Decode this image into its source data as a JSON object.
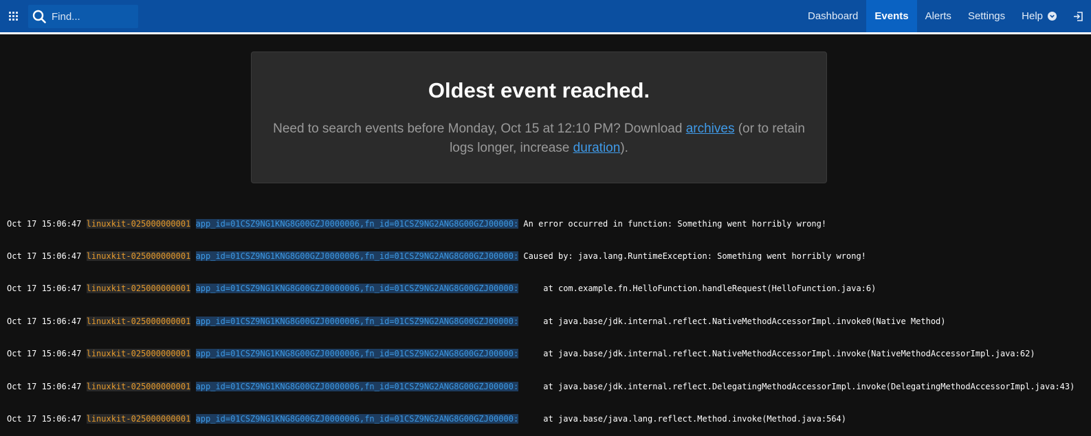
{
  "search": {
    "placeholder": "Find..."
  },
  "nav": {
    "items": [
      {
        "label": "Dashboard"
      },
      {
        "label": "Events",
        "active": true
      },
      {
        "label": "Alerts"
      },
      {
        "label": "Settings"
      },
      {
        "label": "Help"
      }
    ]
  },
  "banner": {
    "title": "Oldest event reached.",
    "message_prefix": "Need to search events before Monday, Oct 15 at 12:10 PM? Download ",
    "archives_link": "archives",
    "message_middle": " (or to retain logs longer, increase ",
    "duration_link": "duration",
    "message_suffix": ")."
  },
  "log": {
    "lines": [
      {
        "time": "Oct 17 15:06:47",
        "host": "linuxkit-025000000001",
        "ids": "app_id=01CSZ9NG1KNG8G00GZJ0000006,fn_id=01CSZ9NG2ANG8G00GZJ00000:",
        "message": "An error occurred in function: Something went horribly wrong!"
      },
      {
        "time": "Oct 17 15:06:47",
        "host": "linuxkit-025000000001",
        "ids": "app_id=01CSZ9NG1KNG8G00GZJ0000006,fn_id=01CSZ9NG2ANG8G00GZJ00000:",
        "message": "Caused by: java.lang.RuntimeException: Something went horribly wrong!"
      },
      {
        "time": "Oct 17 15:06:47",
        "host": "linuxkit-025000000001",
        "ids": "app_id=01CSZ9NG1KNG8G00GZJ0000006,fn_id=01CSZ9NG2ANG8G00GZJ00000:",
        "message": "    at com.example.fn.HelloFunction.handleRequest(HelloFunction.java:6)"
      },
      {
        "time": "Oct 17 15:06:47",
        "host": "linuxkit-025000000001",
        "ids": "app_id=01CSZ9NG1KNG8G00GZJ0000006,fn_id=01CSZ9NG2ANG8G00GZJ00000:",
        "message": "    at java.base/jdk.internal.reflect.NativeMethodAccessorImpl.invoke0(Native Method)"
      },
      {
        "time": "Oct 17 15:06:47",
        "host": "linuxkit-025000000001",
        "ids": "app_id=01CSZ9NG1KNG8G00GZJ0000006,fn_id=01CSZ9NG2ANG8G00GZJ00000:",
        "message": "    at java.base/jdk.internal.reflect.NativeMethodAccessorImpl.invoke(NativeMethodAccessorImpl.java:62)"
      },
      {
        "time": "Oct 17 15:06:47",
        "host": "linuxkit-025000000001",
        "ids": "app_id=01CSZ9NG1KNG8G00GZJ0000006,fn_id=01CSZ9NG2ANG8G00GZJ00000:",
        "message": "    at java.base/jdk.internal.reflect.DelegatingMethodAccessorImpl.invoke(DelegatingMethodAccessorImpl.java:43)"
      },
      {
        "time": "Oct 17 15:06:47",
        "host": "linuxkit-025000000001",
        "ids": "app_id=01CSZ9NG1KNG8G00GZJ0000006,fn_id=01CSZ9NG2ANG8G00GZJ00000:",
        "message": "    at java.base/java.lang.reflect.Method.invoke(Method.java:564)"
      }
    ]
  },
  "colors": {
    "topbar": "#0b4fa0",
    "active_tab": "#0a62c2",
    "host": "#e59a2c",
    "ids": "#3c98e3",
    "link": "#3f9ae8"
  },
  "icons": {
    "apps": "grid-icon",
    "search": "search-icon",
    "help": "chevron-down-icon",
    "logout": "logout-icon"
  }
}
